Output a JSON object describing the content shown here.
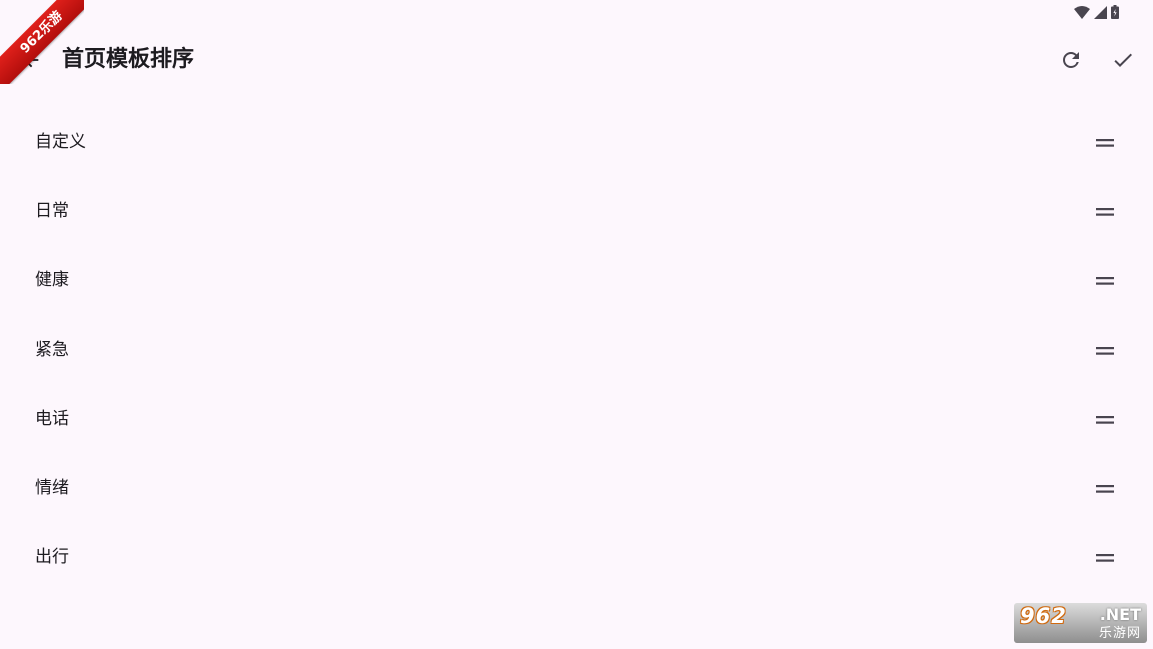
{
  "corner_badge": "962乐游",
  "header": {
    "title": "首页模板排序"
  },
  "list": {
    "items": [
      {
        "label": "自定义"
      },
      {
        "label": "日常"
      },
      {
        "label": "健康"
      },
      {
        "label": "紧急"
      },
      {
        "label": "电话"
      },
      {
        "label": "情绪"
      },
      {
        "label": "出行"
      }
    ]
  },
  "watermark": {
    "number": "962",
    "domain": ".NET",
    "site_name": "乐游网"
  },
  "icons": {
    "back": "arrow-back-icon",
    "refresh": "refresh-icon",
    "confirm": "check-icon",
    "drag": "drag-handle-icon",
    "wifi": "wifi-icon",
    "signal": "signal-icon",
    "battery": "battery-icon"
  },
  "colors": {
    "background": "#fdf7fd",
    "text": "#1d1b20",
    "icon": "#49454f",
    "badge_red": "#d0171a"
  }
}
